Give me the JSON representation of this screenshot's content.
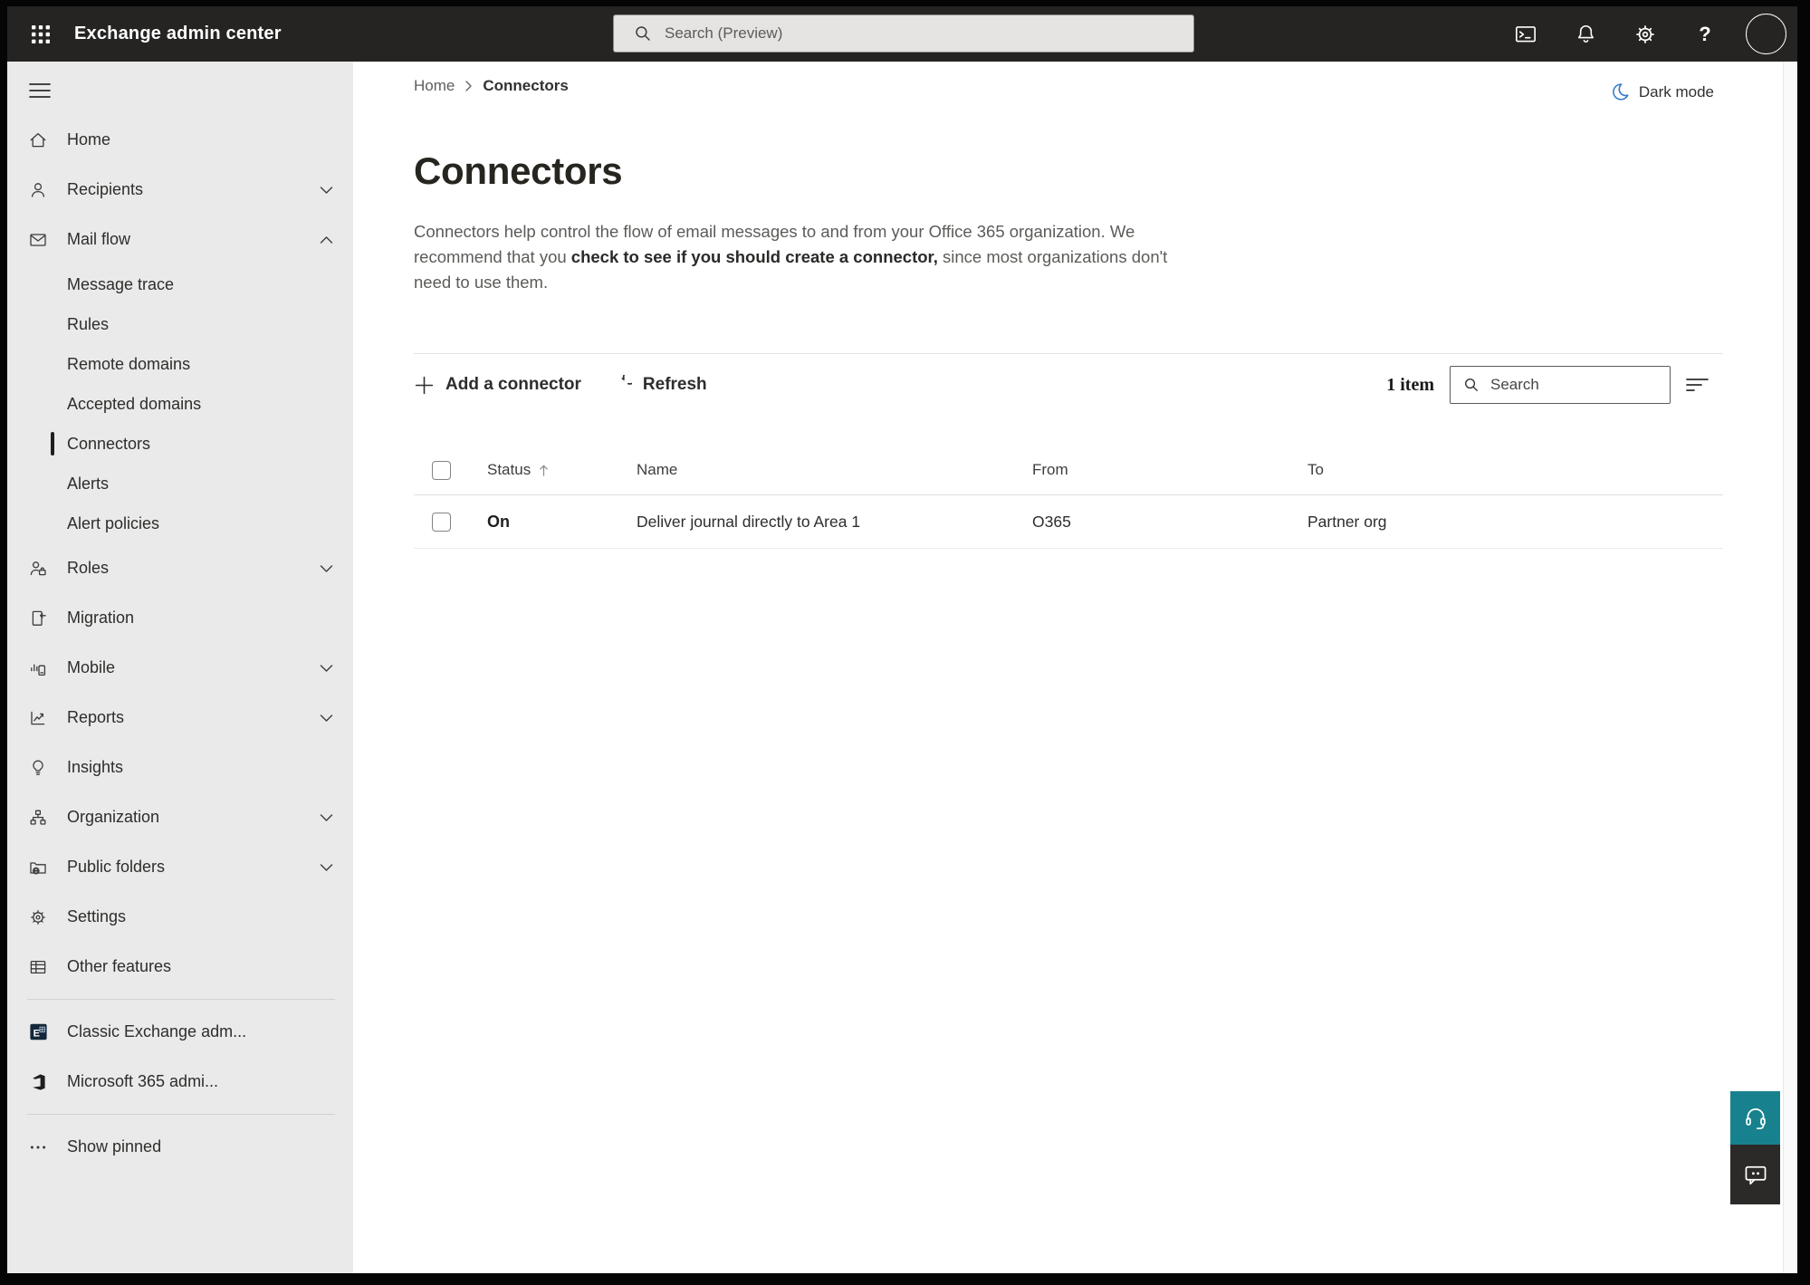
{
  "topbar": {
    "app_title": "Exchange admin center",
    "search_placeholder": "Search (Preview)",
    "icons": [
      "app-launcher-icon",
      "cloud-shell-icon",
      "notifications-icon",
      "settings-icon",
      "help-icon",
      "account-avatar"
    ]
  },
  "sidebar": {
    "selected_item": "Connectors",
    "expanded_section": "Mail flow",
    "items": [
      {
        "label": "Home"
      },
      {
        "label": "Recipients"
      },
      {
        "label": "Mail flow"
      },
      {
        "label": "Message trace"
      },
      {
        "label": "Rules"
      },
      {
        "label": "Remote domains"
      },
      {
        "label": "Accepted domains"
      },
      {
        "label": "Connectors"
      },
      {
        "label": "Alerts"
      },
      {
        "label": "Alert policies"
      },
      {
        "label": "Roles"
      },
      {
        "label": "Migration"
      },
      {
        "label": "Mobile"
      },
      {
        "label": "Reports"
      },
      {
        "label": "Insights"
      },
      {
        "label": "Organization"
      },
      {
        "label": "Public folders"
      },
      {
        "label": "Settings"
      },
      {
        "label": "Other features"
      },
      {
        "label": "Classic Exchange adm..."
      },
      {
        "label": "Microsoft 365 admi..."
      },
      {
        "label": "Show pinned"
      }
    ]
  },
  "page": {
    "breadcrumb_home": "Home",
    "breadcrumb_current": "Connectors",
    "dark_mode_label": "Dark mode",
    "title": "Connectors",
    "description": {
      "pre": "Connectors help control the flow of email messages to and from your Office 365 organization. We recommend that you ",
      "link": "check to see if you should create a connector,",
      "post": " since most organizations don't need to use them."
    }
  },
  "toolbar": {
    "add_label": "Add a connector",
    "refresh_label": "Refresh"
  },
  "list": {
    "count_label": "1 item",
    "search_placeholder": "Search",
    "sort": {
      "column": "Status",
      "direction": "ascending"
    },
    "columns": {
      "status": "Status",
      "name": "Name",
      "from": "From",
      "to": "To"
    },
    "rows": [
      {
        "status": "On",
        "name": "Deliver journal directly to Area 1",
        "from": "O365",
        "to": "Partner org"
      }
    ]
  },
  "colors": {
    "topbar_bg": "#252423",
    "sidebar_bg": "#eaeaea",
    "selected_marker": "#201f1e",
    "support_teal": "#17828e",
    "moon_blue": "#3377c8"
  }
}
